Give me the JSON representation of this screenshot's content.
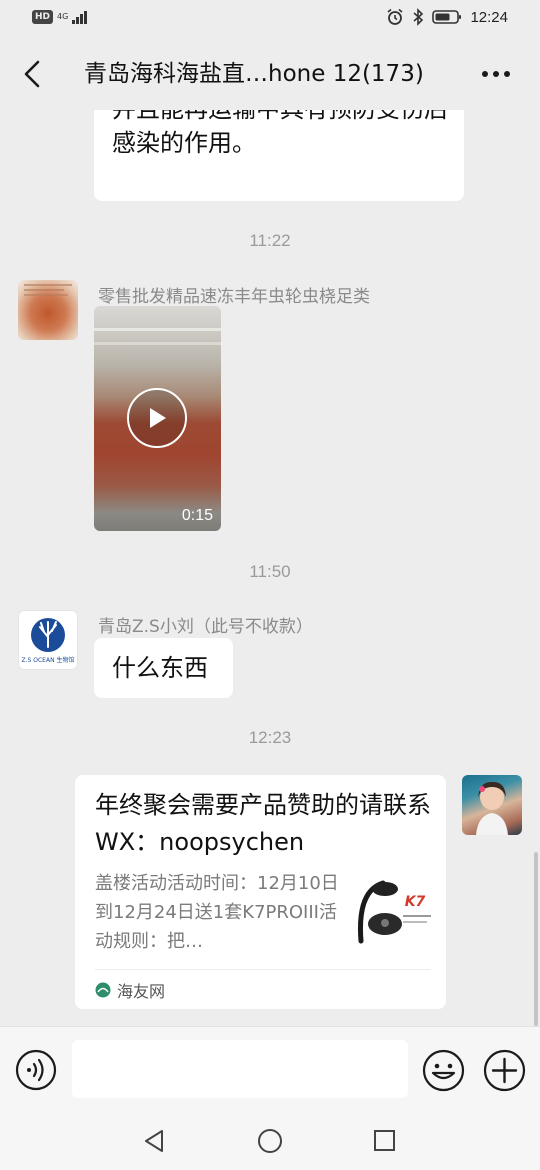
{
  "status_bar": {
    "hd_label": "HD",
    "network_label": "4G",
    "time": "12:24",
    "icons": [
      "hd-icon",
      "signal-icon",
      "alarm-icon",
      "bluetooth-icon",
      "battery-icon"
    ]
  },
  "header": {
    "title": "青岛海科海盐直…hone 12(173)",
    "back_icon": "chevron-left-icon",
    "more_icon": "more-dots-icon"
  },
  "messages": {
    "partial_text_top": "白皮病及水炎病等细菌性感染病并且能再运输中具有预防受伤后感染的作用。",
    "ts1": "11:22",
    "sender1": "零售批发精品速冻丰年虫轮虫桡足类",
    "video_duration": "0:15",
    "ts2": "11:50",
    "sender2": "青岛Z.S小刘（此号不收款）",
    "text2": "什么东西",
    "ts3": "12:23",
    "card": {
      "title": "年终聚会需要产品赞助的请联系WX：noopsychen",
      "desc": "盖楼活动活动时间：12月10日到12月24日送1套K7PROIII活动规则：把…",
      "source": "海友网",
      "thumb_brand": "K7"
    }
  },
  "avatar2_logo_text": "Z.S OCEAN 生物馆",
  "input_bar": {
    "placeholder": "",
    "voice_icon": "voice-icon",
    "emoji_icon": "emoji-icon",
    "plus_icon": "plus-icon"
  },
  "nav_bar": {
    "icons": [
      "nav-back-icon",
      "nav-home-icon",
      "nav-recent-icon"
    ]
  }
}
